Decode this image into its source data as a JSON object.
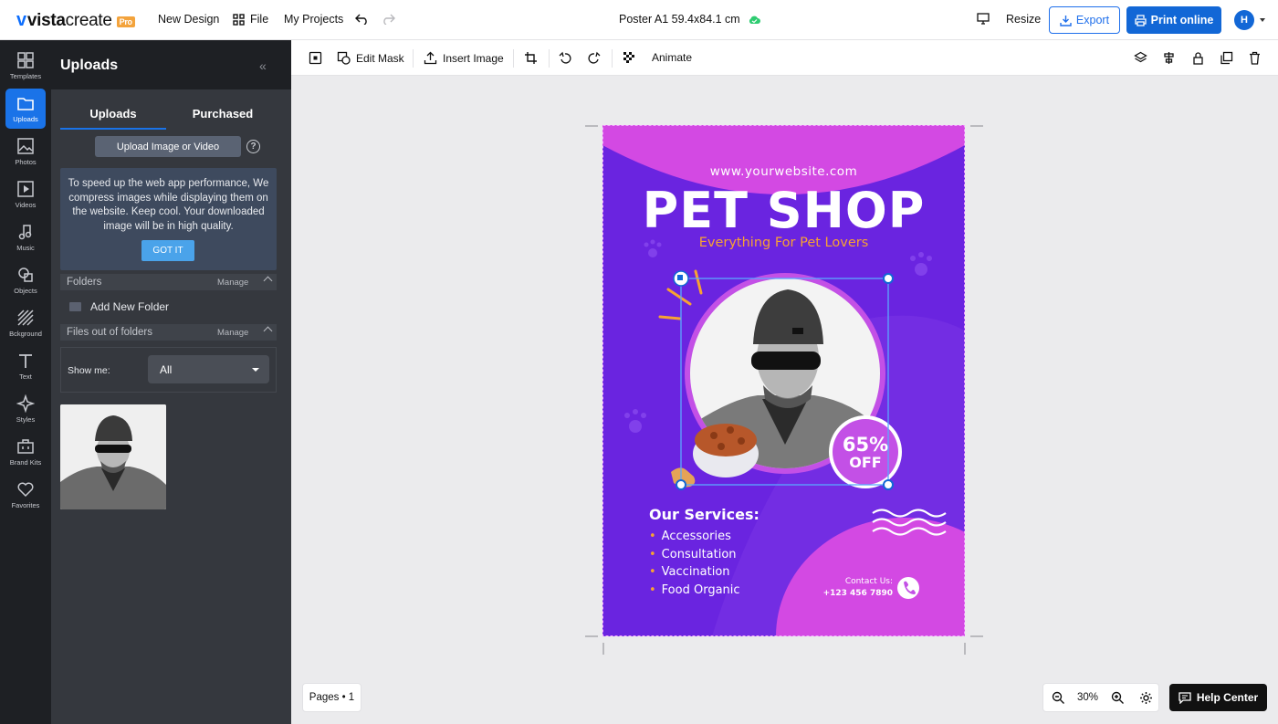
{
  "topbar": {
    "logo_bold": "vista",
    "logo_rest": "create",
    "pro_badge": "Pro",
    "new_design": "New Design",
    "file": "File",
    "my_projects": "My Projects",
    "doc_title": "Poster A1 59.4x84.1 cm",
    "resize": "Resize",
    "export": "Export",
    "print_online": "Print online",
    "avatar_initial": "H"
  },
  "rail": {
    "items": [
      {
        "label": "Templates",
        "icon": "templates-icon"
      },
      {
        "label": "Uploads",
        "icon": "uploads-icon"
      },
      {
        "label": "Photos",
        "icon": "photos-icon"
      },
      {
        "label": "Videos",
        "icon": "videos-icon"
      },
      {
        "label": "Music",
        "icon": "music-icon"
      },
      {
        "label": "Objects",
        "icon": "objects-icon"
      },
      {
        "label": "Bckground",
        "icon": "background-icon"
      },
      {
        "label": "Text",
        "icon": "text-icon"
      },
      {
        "label": "Styles",
        "icon": "styles-icon"
      },
      {
        "label": "Brand Kits",
        "icon": "brand-kits-icon"
      },
      {
        "label": "Favorites",
        "icon": "favorites-icon"
      }
    ]
  },
  "panel": {
    "title": "Uploads",
    "tab_uploads": "Uploads",
    "tab_purchased": "Purchased",
    "upload_button": "Upload Image or Video",
    "notice": "To speed up the web app performance, We compress images while displaying them on the website. Keep cool. Your downloaded image will be in high quality.",
    "got_it": "GOT IT",
    "folders": "Folders",
    "manage": "Manage",
    "add_folder": "Add New Folder",
    "files_out": "Files out of folders",
    "show_me": "Show me:",
    "show_me_value": "All"
  },
  "toolbar": {
    "edit_mask": "Edit Mask",
    "insert_image": "Insert Image",
    "animate": "Animate"
  },
  "poster": {
    "website": "www.yourwebsite.com",
    "title": "PET SHOP",
    "subtitle": "Everything For Pet Lovers",
    "discount_pct": "65%",
    "discount_off": "OFF",
    "services_title": "Our Services:",
    "services": [
      "Accessories",
      "Consultation",
      "Vaccination",
      "Food Organic"
    ],
    "contact_label": "Contact Us:",
    "contact_phone": "+123 456 7890",
    "colors": {
      "background": "#6a24e0",
      "accent_pink": "#d349e3",
      "text_orange": "#f7a233"
    }
  },
  "bottom": {
    "pages": "Pages • 1",
    "zoom": "30%",
    "help_center": "Help Center"
  }
}
